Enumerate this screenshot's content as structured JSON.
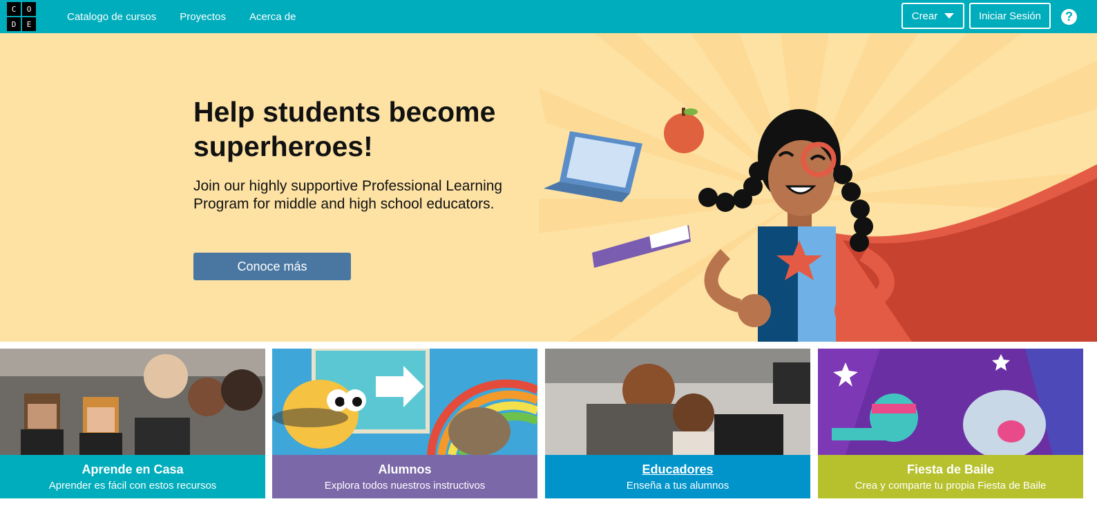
{
  "header": {
    "logo_letters": [
      "C",
      "O",
      "D",
      "E"
    ],
    "nav": [
      "Catalogo de cursos",
      "Proyectos",
      "Acerca de"
    ],
    "create_label": "Crear",
    "signin_label": "Iniciar Sesión",
    "help_symbol": "?",
    "bar_color": "#00adbc"
  },
  "hero": {
    "title": "Help students become superheroes!",
    "text": "Join our highly supportive Professional Learning Program for middle and high school educators.",
    "button_label": "Conoce más",
    "background_color": "#fde2a4"
  },
  "cards": [
    {
      "title": "Aprende en Casa",
      "subtitle": "Aprender es fácil con estos recursos",
      "band_color": "#00adbc"
    },
    {
      "title": "Alumnos",
      "subtitle": "Explora todos nuestros instructivos",
      "band_color": "#7b68a8"
    },
    {
      "title": "Educadores",
      "subtitle": "Enseña a tus alumnos",
      "band_color": "#0094ca"
    },
    {
      "title": "Fiesta de Baile",
      "subtitle": "Crea y comparte tu propia Fiesta de Baile",
      "band_color": "#b7c12d"
    }
  ]
}
